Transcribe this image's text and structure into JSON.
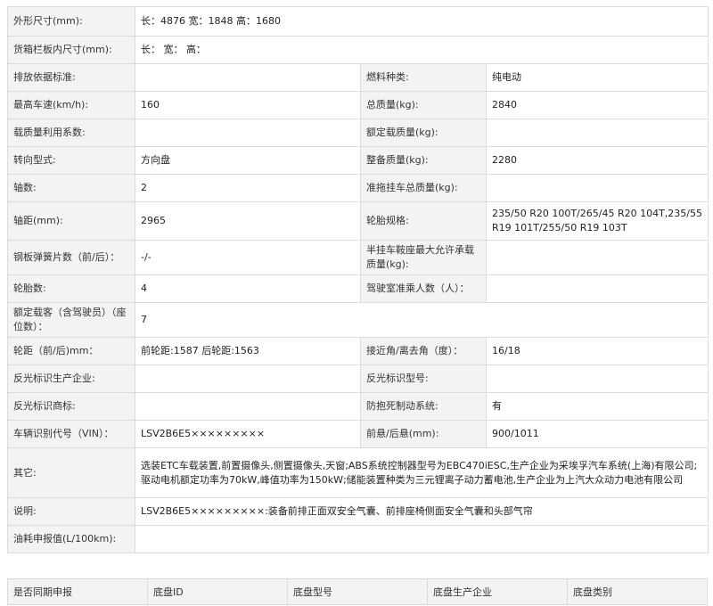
{
  "rows": [
    {
      "label": "外形尺寸(mm):",
      "value": "长：4876 宽：1848 高：1680"
    },
    {
      "label": "货箱栏板内尺寸(mm):",
      "value": "长：  宽：  高："
    },
    {
      "label": "排放依据标准:",
      "value": "",
      "label2": "燃料种类:",
      "value2": "纯电动"
    },
    {
      "label": "最高车速(km/h):",
      "value": "160",
      "label2": "总质量(kg):",
      "value2": "2840"
    },
    {
      "label": "载质量利用系数:",
      "value": "",
      "label2": "额定载质量(kg):",
      "value2": ""
    },
    {
      "label": "转向型式:",
      "value": "方向盘",
      "label2": "整备质量(kg):",
      "value2": "2280"
    },
    {
      "label": "轴数:",
      "value": "2",
      "label2": "准拖挂车总质量(kg):",
      "value2": ""
    },
    {
      "label": "轴距(mm):",
      "value": "2965",
      "label2": "轮胎规格:",
      "value2": "235/50 R20 100T/265/45 R20 104T,235/55 R19 101T/255/50 R19 103T"
    },
    {
      "label": "钢板弹簧片数（前/后）：",
      "value": "-/-",
      "label2": "半挂车鞍座最大允许承载质量(kg):",
      "value2": ""
    },
    {
      "label": "轮胎数:",
      "value": "4",
      "label2": "驾驶室准乘人数（人）：",
      "value2": ""
    },
    {
      "label": "额定载客（含驾驶员）（座位数）：",
      "value": "7"
    },
    {
      "label": "轮距（前/后)mm：",
      "value": "前轮距:1587 后轮距:1563",
      "label2": "接近角/离去角（度）：",
      "value2": "16/18"
    },
    {
      "label": "反光标识生产企业:",
      "value": "",
      "label2": "反光标识型号:",
      "value2": ""
    },
    {
      "label": "反光标识商标:",
      "value": "",
      "label2": "防抱死制动系统:",
      "value2": "有"
    },
    {
      "label": "车辆识别代号（VIN）：",
      "value": "LSV2B6E5×××××××××",
      "label2": "前悬/后悬(mm):",
      "value2": "900/1011"
    },
    {
      "label": "其它:",
      "value": "选装ETC车载装置,前置摄像头,侧置摄像头,天窗;ABS系统控制器型号为EBC470iESC,生产企业为采埃孚汽车系统(上海)有限公司;驱动电机额定功率为70kW,峰值功率为150kW;储能装置种类为三元锂离子动力蓄电池,生产企业为上汽大众动力电池有限公司"
    },
    {
      "label": "说明:",
      "value": "LSV2B6E5×××××××××:装备前排正面双安全气囊、前排座椅侧面安全气囊和头部气帘"
    },
    {
      "label": "油耗申报值(L/100km):",
      "value": ""
    }
  ],
  "chassis_headers": [
    "是否同期申报",
    "底盘ID",
    "底盘型号",
    "底盘生产企业",
    "底盘类别"
  ]
}
